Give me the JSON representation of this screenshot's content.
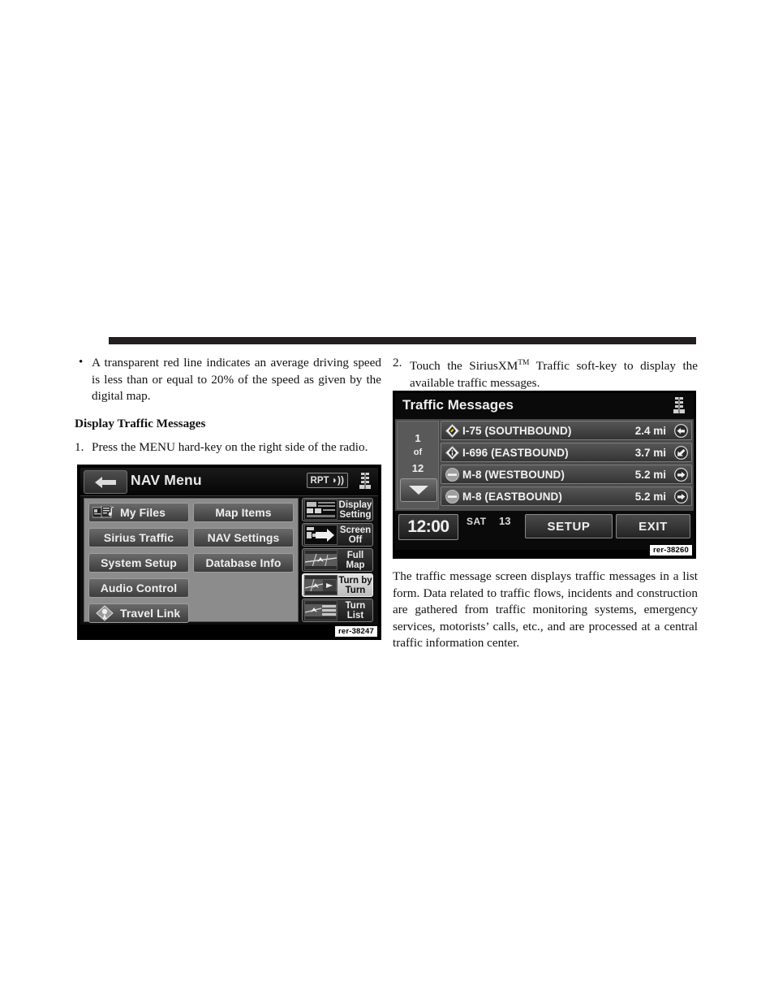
{
  "left_column": {
    "bullet": {
      "marker": "•",
      "text": "A transparent red line indicates an average driving speed is less than or equal to 20% of the speed as given by the digital map."
    },
    "subheading": "Display Traffic Messages",
    "step1": {
      "number": "1.",
      "text": "Press the MENU hard-key on the right side of the radio."
    }
  },
  "right_column": {
    "step2": {
      "number": "2.",
      "text_before": "Touch the SiriusXM",
      "trademark": "TM",
      "text_after": " Traffic soft-key to display the available traffic messages."
    },
    "paragraph": "The traffic message screen displays traffic messages in a list form. Data related to traffic flows, incidents and construction are gathered from traffic monitoring systems, emergency services, motorists’ calls, etc., and are processed at a central traffic information center."
  },
  "nav_menu_screenshot": {
    "caption": "rer-38247",
    "title": "NAV Menu",
    "back_icon": "back-arrow-icon",
    "rpt_badge": "RPT",
    "seat_icon": "seat-climate-icon",
    "left_buttons": [
      {
        "label": "My Files",
        "icon": "media-files-icon",
        "column": 0,
        "row": 0
      },
      {
        "label": "Map Items",
        "icon": "",
        "column": 1,
        "row": 0
      },
      {
        "label": "Sirius Traffic",
        "icon": "",
        "column": 0,
        "row": 1
      },
      {
        "label": "NAV Settings",
        "icon": "",
        "column": 1,
        "row": 1
      },
      {
        "label": "System Setup",
        "icon": "",
        "column": 0,
        "row": 2
      },
      {
        "label": "Database Info",
        "icon": "",
        "column": 1,
        "row": 2
      },
      {
        "label": "Audio Control",
        "icon": "",
        "column": 0,
        "row": 3
      },
      {
        "label": "Travel Link",
        "icon": "travel-link-diamond-icon",
        "column": 0,
        "row": 4
      }
    ],
    "side_buttons": [
      {
        "line1": "Display",
        "line2": "Setting",
        "icon": "display-setting-thumb",
        "selected": false
      },
      {
        "line1": "Screen",
        "line2": "Off",
        "icon": "screen-off-thumb",
        "selected": false
      },
      {
        "line1": "Full",
        "line2": "Map",
        "icon": "full-map-thumb",
        "selected": false
      },
      {
        "line1": "Turn by",
        "line2": "Turn",
        "icon": "turn-by-turn-thumb",
        "selected": true
      },
      {
        "line1": "Turn",
        "line2": "List",
        "icon": "turn-list-thumb",
        "selected": false
      }
    ]
  },
  "traffic_screenshot": {
    "caption": "rer-38260",
    "title": "Traffic Messages",
    "seat_icon": "seat-climate-icon",
    "pager": {
      "current": "1",
      "of": "of",
      "total": "12",
      "down_icon": "chevron-down-icon"
    },
    "rows": [
      {
        "icon": "diamond-incident-icon",
        "name": "I-75 (SOUTHBOUND)",
        "distance": "2.4 mi",
        "direction_icon": "arrow-left-circle-icon"
      },
      {
        "icon": "diamond-info-icon",
        "name": "I-696 (EASTBOUND)",
        "distance": "3.7 mi",
        "direction_icon": "arrow-down-left-circle-icon"
      },
      {
        "icon": "circle-closed-icon",
        "name": "M-8 (WESTBOUND)",
        "distance": "5.2 mi",
        "direction_icon": "arrow-right-circle-icon"
      },
      {
        "icon": "circle-closed-icon",
        "name": "M-8 (EASTBOUND)",
        "distance": "5.2 mi",
        "direction_icon": "arrow-right-circle-icon"
      }
    ],
    "footer": {
      "clock": "12:00",
      "day": "SAT",
      "date": "13",
      "setup_label": "SETUP",
      "exit_label": "EXIT"
    }
  },
  "colors": {
    "rule": "#231f20",
    "screen_black": "#000000",
    "button_light": "#e2e2e2"
  }
}
